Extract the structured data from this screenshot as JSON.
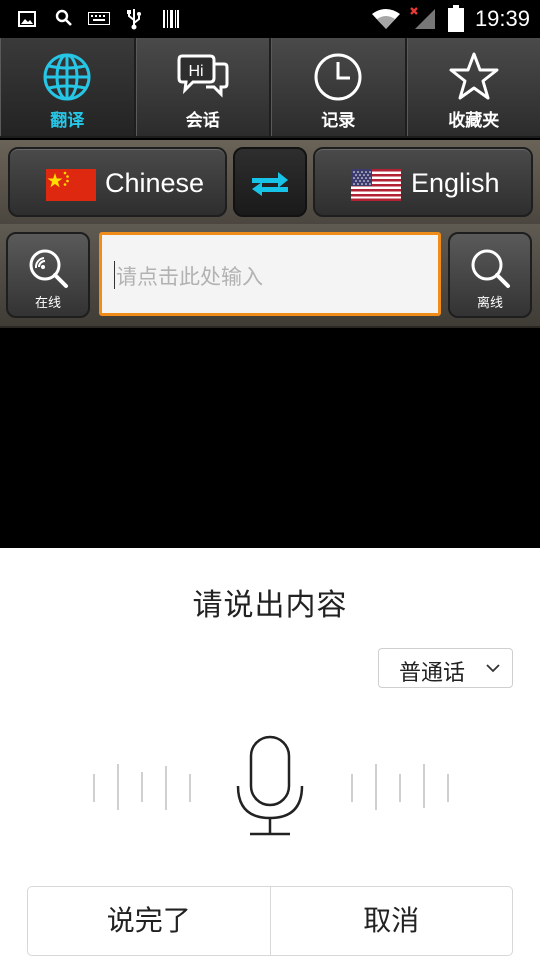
{
  "status_bar": {
    "time": "19:39",
    "icons": [
      "gallery-icon",
      "search-icon",
      "keyboard-icon",
      "usb-icon",
      "barcode-icon",
      "wifi-icon",
      "signal-icon",
      "battery-icon"
    ]
  },
  "tabs": [
    {
      "label": "翻译",
      "icon": "globe-icon",
      "active": true
    },
    {
      "label": "会话",
      "icon": "chat-bubble-icon",
      "active": false
    },
    {
      "label": "记录",
      "icon": "clock-icon",
      "active": false
    },
    {
      "label": "收藏夹",
      "icon": "star-icon",
      "active": false
    }
  ],
  "language_bar": {
    "source": "Chinese",
    "target": "English",
    "source_flag": "china-flag-icon",
    "target_flag": "usa-flag-icon",
    "swap_icon": "swap-arrows-icon"
  },
  "search": {
    "online_label": "在线",
    "offline_label": "离线",
    "placeholder": "请点击此处输入",
    "value": ""
  },
  "voice_dialog": {
    "title": "请说出内容",
    "language_selected": "普通话",
    "done_label": "说完了",
    "cancel_label": "取消"
  },
  "colors": {
    "accent_active_tab": "#26c6e6",
    "input_border": "#f08d1a",
    "swap_arrows": "#17c3e6"
  }
}
